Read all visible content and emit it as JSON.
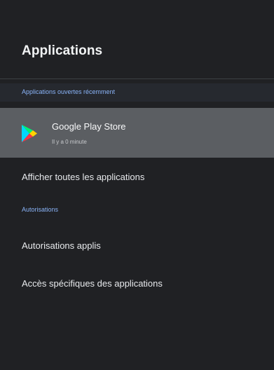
{
  "header": {
    "title": "Applications"
  },
  "recent": {
    "section_label": "Applications ouvertes récemment",
    "apps": [
      {
        "name": "Google Play Store",
        "time": "Il y a 0 minute",
        "icon": "google-play-store-icon"
      }
    ]
  },
  "actions": {
    "show_all_label": "Afficher toutes les applications"
  },
  "permissions": {
    "section_label": "Autorisations",
    "items": [
      {
        "label": "Autorisations applis"
      },
      {
        "label": "Accès spécifiques des applications"
      }
    ]
  },
  "colors": {
    "background": "#202124",
    "section_label": "#8ab4f8",
    "selected_row": "#5b5e62",
    "text": "#e8eaed"
  }
}
